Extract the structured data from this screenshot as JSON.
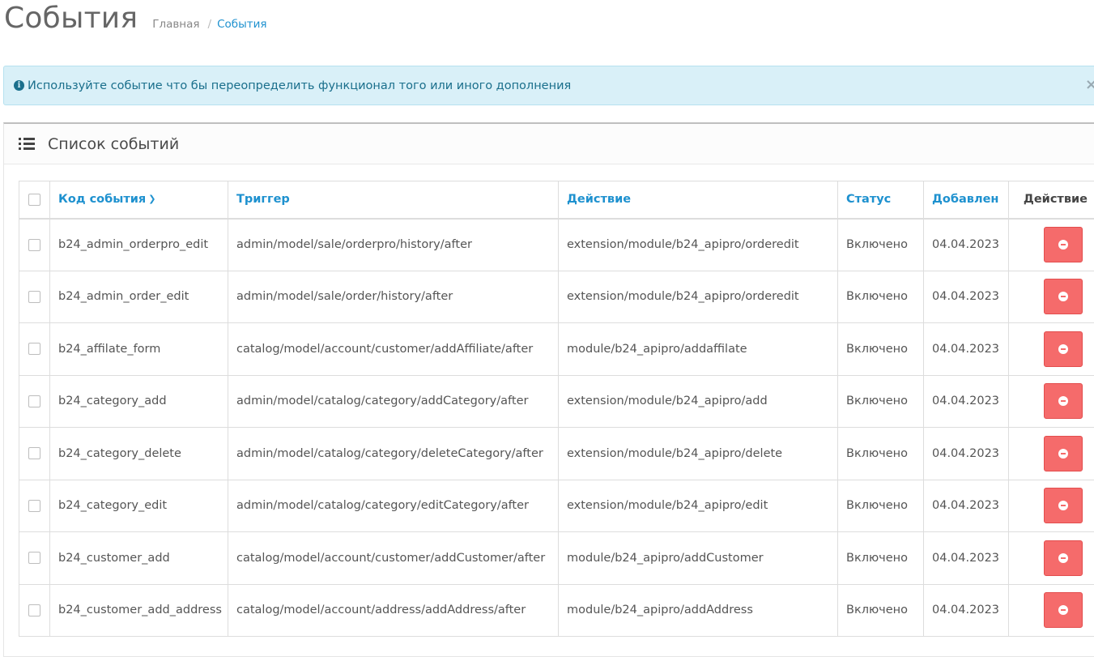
{
  "header": {
    "title": "События",
    "breadcrumb": {
      "home": "Главная",
      "separator": "/",
      "current": "События"
    }
  },
  "alert": {
    "icon": "info-circle-icon",
    "text": "Используйте событие что бы переопределить функционал того или иного дополнения",
    "close": "×"
  },
  "panel": {
    "icon": "list-icon",
    "title": "Список событий"
  },
  "table": {
    "columns": {
      "code": "Код события",
      "trigger": "Триггер",
      "action": "Действие",
      "status": "Статус",
      "added": "Добавлен",
      "operation": "Действие"
    },
    "sort_icon": "chevron-down-icon",
    "rows": [
      {
        "code": "b24_admin_orderpro_edit",
        "trigger": "admin/model/sale/orderpro/history/after",
        "action": "extension/module/b24_apipro/orderedit",
        "status": "Включено",
        "added": "04.04.2023"
      },
      {
        "code": "b24_admin_order_edit",
        "trigger": "admin/model/sale/order/history/after",
        "action": "extension/module/b24_apipro/orderedit",
        "status": "Включено",
        "added": "04.04.2023"
      },
      {
        "code": "b24_affilate_form",
        "trigger": "catalog/model/account/customer/addAffiliate/after",
        "action": "module/b24_apipro/addaffilate",
        "status": "Включено",
        "added": "04.04.2023"
      },
      {
        "code": "b24_category_add",
        "trigger": "admin/model/catalog/category/addCategory/after",
        "action": "extension/module/b24_apipro/add",
        "status": "Включено",
        "added": "04.04.2023"
      },
      {
        "code": "b24_category_delete",
        "trigger": "admin/model/catalog/category/deleteCategory/after",
        "action": "extension/module/b24_apipro/delete",
        "status": "Включено",
        "added": "04.04.2023"
      },
      {
        "code": "b24_category_edit",
        "trigger": "admin/model/catalog/category/editCategory/after",
        "action": "extension/module/b24_apipro/edit",
        "status": "Включено",
        "added": "04.04.2023"
      },
      {
        "code": "b24_customer_add",
        "trigger": "catalog/model/account/customer/addCustomer/after",
        "action": "module/b24_apipro/addCustomer",
        "status": "Включено",
        "added": "04.04.2023"
      },
      {
        "code": "b24_customer_add_address",
        "trigger": "catalog/model/account/address/addAddress/after",
        "action": "module/b24_apipro/addAddress",
        "status": "Включено",
        "added": "04.04.2023"
      }
    ]
  },
  "colors": {
    "link": "#1e91cf",
    "alert_bg": "#d9f0f8",
    "danger": "#f56b6b"
  }
}
